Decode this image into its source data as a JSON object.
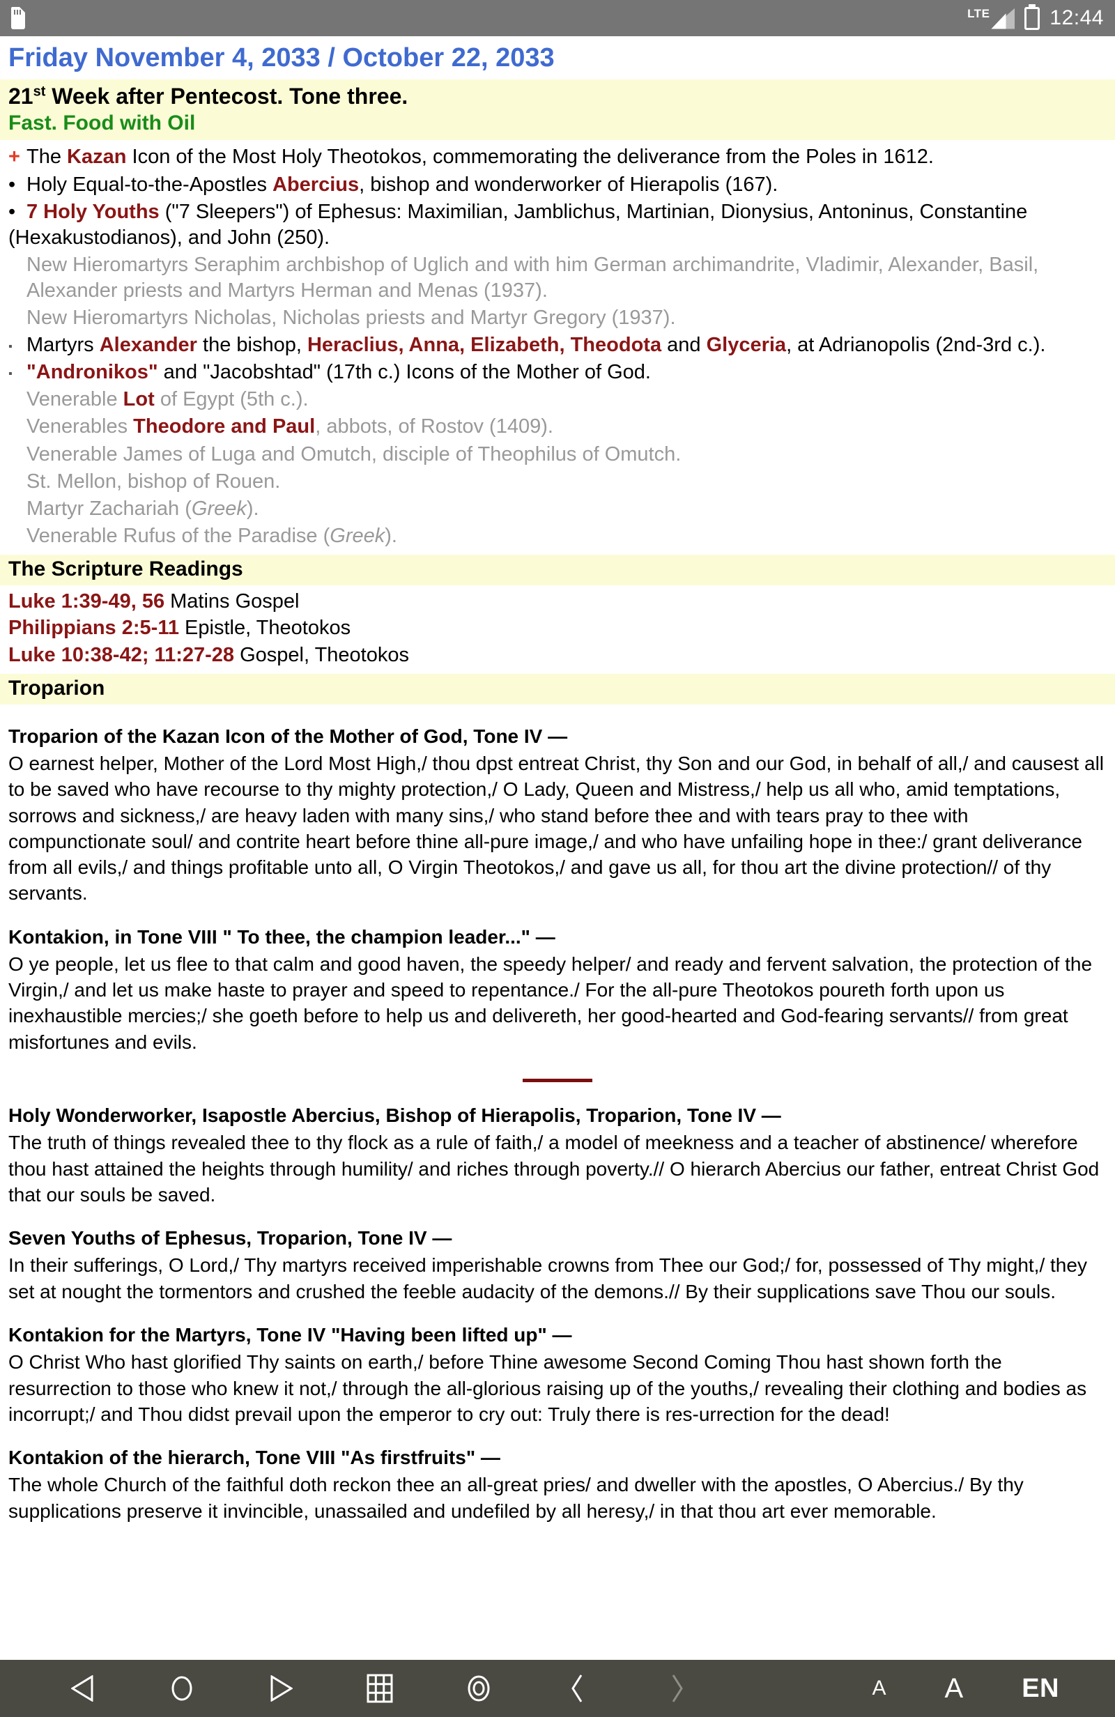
{
  "status_bar": {
    "sdcard_icon": "sdcard-icon",
    "network_label": "LTE",
    "signal_icon": "signal-bars-icon",
    "battery_icon": "battery-charging-icon",
    "clock": "12:44"
  },
  "page": {
    "title": "Friday November 4, 2033 / October 22, 2033",
    "week_line_prefix": "21",
    "week_line_sup": "st",
    "week_line_rest": " Week after Pentecost. Tone three.",
    "fast_line": "Fast. Food with Oil"
  },
  "saints": [
    {
      "marker": "+",
      "style": "cross",
      "parts": [
        {
          "t": "The ",
          "k": "n"
        },
        {
          "t": "Kazan",
          "k": "hl"
        },
        {
          "t": " Icon of the Most Holy Theotokos, commemorating the deliverance from the Poles in 1612.",
          "k": "n"
        }
      ]
    },
    {
      "marker": "•",
      "style": "dot",
      "parts": [
        {
          "t": "Holy Equal-to-the-Apostles ",
          "k": "n"
        },
        {
          "t": "Abercius",
          "k": "hl"
        },
        {
          "t": ", bishop and wonderworker of Hierapolis (167).",
          "k": "n"
        }
      ]
    },
    {
      "marker": "•",
      "style": "dot",
      "parts": [
        {
          "t": "7 Holy Youths",
          "k": "hl"
        },
        {
          "t": " (\"7 Sleepers\") of Ephesus: Maximilian, Jamblichus, Martinian, Dionysius, Antoninus, Constantine (Hexakustodianos), and John (250).",
          "k": "n"
        }
      ]
    },
    {
      "marker": "",
      "style": "grey",
      "parts": [
        {
          "t": "New Hieromartyrs Seraphim archbishop of Uglich and with him German archimandrite, Vladimir, Alexander, Basil, Alexander priests and Martyrs Herman and Menas (1937).",
          "k": "n"
        }
      ]
    },
    {
      "marker": "",
      "style": "grey",
      "parts": [
        {
          "t": "New Hieromartyrs Nicholas, Nicholas priests and Martyr Gregory (1937).",
          "k": "n"
        }
      ]
    },
    {
      "marker": "▪",
      "style": "sq",
      "parts": [
        {
          "t": "Martyrs ",
          "k": "n"
        },
        {
          "t": "Alexander",
          "k": "hl"
        },
        {
          "t": " the bishop, ",
          "k": "n"
        },
        {
          "t": "Heraclius, Anna, Elizabeth, Theodota",
          "k": "hl"
        },
        {
          "t": " and ",
          "k": "n"
        },
        {
          "t": "Glyceria",
          "k": "hl"
        },
        {
          "t": ", at Adrianopolis (2nd-3rd c.).",
          "k": "n"
        }
      ]
    },
    {
      "marker": "▪",
      "style": "sq",
      "parts": [
        {
          "t": "\"Andronikos\"",
          "k": "hl"
        },
        {
          "t": " and \"Jacobshtad\" (17th c.) Icons of the Mother of God.",
          "k": "n"
        }
      ]
    },
    {
      "marker": "",
      "style": "grey",
      "parts": [
        {
          "t": "Venerable ",
          "k": "n"
        },
        {
          "t": "Lot",
          "k": "hl"
        },
        {
          "t": " of Egypt (5th c.).",
          "k": "n"
        }
      ]
    },
    {
      "marker": "",
      "style": "grey",
      "parts": [
        {
          "t": "Venerables ",
          "k": "n"
        },
        {
          "t": "Theodore and Paul",
          "k": "hl"
        },
        {
          "t": ", abbots, of Rostov (1409).",
          "k": "n"
        }
      ]
    },
    {
      "marker": "",
      "style": "grey",
      "parts": [
        {
          "t": "Venerable James of Luga and Omutch, disciple of Theophilus of Omutch.",
          "k": "n"
        }
      ]
    },
    {
      "marker": "",
      "style": "grey",
      "parts": [
        {
          "t": "St. Mellon, bishop of Rouen.",
          "k": "n"
        }
      ]
    },
    {
      "marker": "",
      "style": "grey",
      "parts": [
        {
          "t": "Martyr Zachariah (",
          "k": "n"
        },
        {
          "t": "Greek",
          "k": "it"
        },
        {
          "t": ").",
          "k": "n"
        }
      ]
    },
    {
      "marker": "",
      "style": "grey",
      "parts": [
        {
          "t": "Venerable Rufus of the Paradise (",
          "k": "n"
        },
        {
          "t": "Greek",
          "k": "it"
        },
        {
          "t": ").",
          "k": "n"
        }
      ]
    }
  ],
  "scripture": {
    "heading": "The Scripture Readings",
    "items": [
      {
        "ref": "Luke 1:39-49, 56",
        "desc": " Matins Gospel"
      },
      {
        "ref": "Philippians 2:5-11",
        "desc": " Epistle, Theotokos"
      },
      {
        "ref": "Luke 10:38-42; 11:27-28",
        "desc": " Gospel, Theotokos"
      }
    ]
  },
  "troparion": {
    "heading": "Troparion",
    "hymns": [
      {
        "title": "Troparion of the Kazan Icon of the Mother of God, Tone IV —",
        "body": "O earnest helper, Mother of the Lord Most High,/ thou dpst entreat Christ, thy Son and our God, in behalf of all,/ and causest all to be saved who have recourse to thy mighty protection,/ O Lady, Queen and Mistress,/ help us all who, amid temptations, sorrows and sickness,/ are heavy laden with many sins,/ who stand before thee and with tears pray to thee with compunctionate soul/ and contrite heart before thine all-pure image,/ and who have unfailing hope in thee:/ grant deliverance from all evils,/ and things profitable unto all, O Virgin Theotokos,/ and gave us all, for thou art the divine protection// of thy servants."
      },
      {
        "title": "Kontakion, in Tone VIII \" To thee, the champion leader...\" —",
        "body": "O ye people, let us flee to that calm and good haven, the speedy helper/ and ready and fervent salvation, the protection of the Virgin,/ and let us make haste to prayer and speed to repentance./ For the all-pure Theotokos poureth forth upon us inexhaustible mercies;/ she goeth before to help us and delivereth, her good-hearted and God-fearing servants// from great misfortunes and evils."
      },
      {
        "title": "Holy Wonderworker, Isapostle Abercius, Bishop of Hierapolis, Troparion, Tone IV —",
        "body": "The truth of things revealed thee to thy flock as a rule of faith,/ a model of meekness and a teacher of abstinence/ wherefore thou hast attained the heights through humility/ and riches through poverty.// O hierarch Abercius our father, entreat Christ God that our souls be saved."
      },
      {
        "title": "Seven Youths of Ephesus, Troparion, Tone IV —",
        "body": "In their sufferings, O Lord,/ Thy martyrs received imperishable crowns from Thee our God;/ for, possessed of Thy might,/ they set at nought the tormentors and crushed the feeble audacity of the demons.// By their supplications save Thou our souls."
      },
      {
        "title": "Kontakion for the Martyrs, Tone IV \"Having been lifted up\" —",
        "body": "O Christ Who hast glorified Thy saints on earth,/ before Thine awesome Second Coming Thou hast shown forth the resurrection to those who knew it not,/ through the all-glorious raising up of the youths,/ revealing their clothing and bodies as incorrupt;/ and Thou didst prevail upon the emperor to cry out: Truly there is res-urrection for the dead!"
      },
      {
        "title": "Kontakion of the hierarch, Tone VIII \"As firstfruits\" —",
        "body": "The whole Church of the faithful doth reckon thee an all-great pries/ and dweller with the apostles, O Abercius./ By thy supplications preserve it invincible, unassailed and undefiled by all heresy,/ in that thou art ever memorable."
      }
    ]
  },
  "nav_bar": {
    "back_icon": "back-triangle-icon",
    "home_icon": "home-circle-icon",
    "forward_icon": "forward-triangle-icon",
    "grid_icon": "grid-icon",
    "target_icon": "target-circle-icon",
    "prev_icon": "chevron-left-icon",
    "next_icon": "chevron-right-icon",
    "font_small": "A",
    "font_large": "A",
    "language": "EN"
  },
  "colors": {
    "title_blue": "#3f6ad0",
    "band_yellow": "#fbfbd6",
    "fast_green": "#1a8c1a",
    "highlight_red": "#8b1515",
    "cross_red": "#e23b28",
    "status_grey": "#757575",
    "nav_grey": "#4a4a42"
  }
}
